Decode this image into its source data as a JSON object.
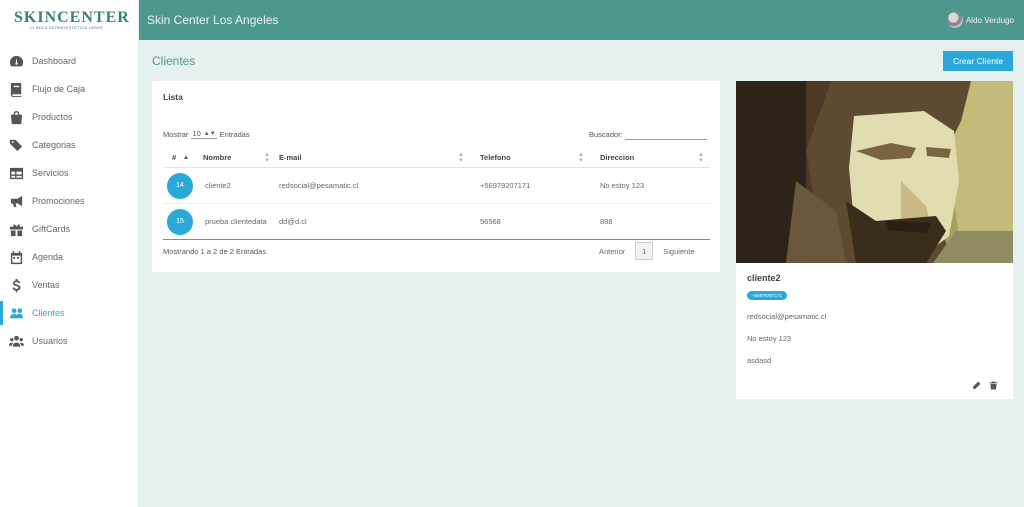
{
  "brand": {
    "title": "SKINCENTER",
    "subtitle": "CLINICA DERMOESTETICA LASER"
  },
  "header": {
    "title": "Skin Center Los Angeles",
    "user_name": "Aldo Verdugo"
  },
  "sidebar": {
    "items": [
      {
        "label": "Dashboard",
        "icon": "dashboard-icon"
      },
      {
        "label": "Flujo de Caja",
        "icon": "book-icon"
      },
      {
        "label": "Productos",
        "icon": "shopping-bag-icon"
      },
      {
        "label": "Categorias",
        "icon": "tags-icon"
      },
      {
        "label": "Servicios",
        "icon": "table-icon"
      },
      {
        "label": "Promociones",
        "icon": "bullhorn-icon"
      },
      {
        "label": "GiftCards",
        "icon": "gift-icon"
      },
      {
        "label": "Agenda",
        "icon": "calendar-icon"
      },
      {
        "label": "Ventas",
        "icon": "dollar-icon"
      },
      {
        "label": "Clientes",
        "icon": "users-icon",
        "active": true
      },
      {
        "label": "Usuarios",
        "icon": "users-group-icon"
      }
    ]
  },
  "page": {
    "title": "Clientes",
    "create_button": "Crear Cliente"
  },
  "list": {
    "title": "Lista",
    "show_label": "Mostrar",
    "show_value": "10",
    "entries_label": "Entradas",
    "search_label": "Buscador:",
    "columns": [
      "#",
      "Nombre",
      "E-mail",
      "Telefono",
      "Direccion"
    ],
    "rows": [
      {
        "id": "14",
        "nombre": "cliente2",
        "email": "redsocial@pesamatic.cl",
        "telefono": "+56979207171",
        "direccion": "No estoy 123"
      },
      {
        "id": "15",
        "nombre": "prueba clientedata",
        "email": "dd@d.cl",
        "telefono": "56568",
        "direccion": "888"
      }
    ],
    "info": "Mostrando 1 a 2 de 2 Entradas",
    "prev": "Anterior",
    "page": "1",
    "next": "Siguiente"
  },
  "profile": {
    "name": "cliente2",
    "phone": "+56979207171",
    "email": "redsocial@pesamatic.cl",
    "address": "No estoy 123",
    "note": "asdasd"
  },
  "colors": {
    "header": "#4e978f",
    "accent": "#2aa8d8",
    "background": "#e6f0ee"
  }
}
